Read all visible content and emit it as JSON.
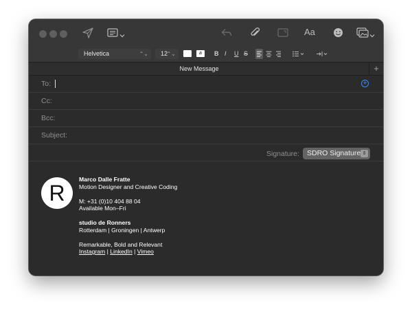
{
  "toolbar": {
    "icons": [
      "send-icon",
      "header-fields-icon",
      "chevron-down-icon",
      "reply-icon",
      "attachment-icon",
      "photo-browser-icon",
      "format-icon",
      "emoji-icon",
      "photo-icon",
      "chevron-down-icon"
    ],
    "format_label": "Aa"
  },
  "format_bar": {
    "font": "Helvetica",
    "size": "12",
    "text_color_swatch": "#ffffff",
    "bold": "B",
    "italic": "I",
    "underline": "U",
    "strike": "S"
  },
  "tab": {
    "title": "New Message",
    "add": "+"
  },
  "fields": {
    "to": "To:",
    "cc": "Cc:",
    "bcc": "Bcc:",
    "subject": "Subject:"
  },
  "signature": {
    "label": "Signature:",
    "selected": "SDRO Signature"
  },
  "sig_block": {
    "logo": "R",
    "name": "Marco Dalle Fratte",
    "role": "Motion Designer and Creative Coding",
    "phone": "M: +31 (0)10 404 88 04",
    "availability": "Available Mon–Fri",
    "company": "studio de Ronners",
    "locations": "Rotterdam | Groningen | Antwerp",
    "tagline": "Remarkable, Bold and Relevant",
    "links": [
      "Instagram",
      "LinkedIn",
      "Vimeo"
    ],
    "separator": " | "
  },
  "colors": {
    "window": "#2b2b2b",
    "toolbar": "#373737",
    "accent": "#3d8bfd",
    "text": "#ffffff",
    "muted": "#8f8f8f"
  }
}
